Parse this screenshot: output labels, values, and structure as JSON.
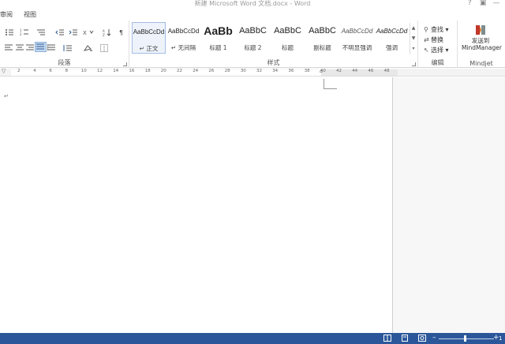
{
  "window": {
    "title": "新建 Microsoft Word 文档.docx - Word",
    "controls": [
      "?",
      "▣",
      "—"
    ]
  },
  "tabs": [
    "审阅",
    "视图"
  ],
  "ribbon": {
    "paragraph_group_label": "段落",
    "styles_group_label": "样式",
    "editing_group_label": "编辑",
    "mindjet_group_label": "Mindjet",
    "styles": [
      {
        "sample": "AaBbCcDd",
        "name": "↵ 正文",
        "selected": true
      },
      {
        "sample": "AaBbCcDd",
        "name": "↵ 无间隔",
        "selected": false
      },
      {
        "sample": "AaBb",
        "name": "标题 1",
        "selected": false
      },
      {
        "sample": "AaBbC",
        "name": "标题 2",
        "selected": false
      },
      {
        "sample": "AaBbC",
        "name": "标题",
        "selected": false
      },
      {
        "sample": "AaBbC",
        "name": "副标题",
        "selected": false
      },
      {
        "sample": "AaBbCcDd",
        "name": "不明显强调",
        "selected": false
      },
      {
        "sample": "AaBbCcDd",
        "name": "强调",
        "selected": false
      }
    ],
    "editing": {
      "find": "查找",
      "replace": "替换",
      "select": "选择"
    },
    "mindjet": {
      "line1": "发送到",
      "line2": "MindManager"
    }
  },
  "ruler": {
    "numbers": [
      "2",
      "4",
      "6",
      "8",
      "10",
      "12",
      "14",
      "16",
      "18",
      "20",
      "22",
      "24",
      "26",
      "28",
      "30",
      "32",
      "34",
      "36",
      "38",
      "40",
      "42",
      "44",
      "46",
      "48"
    ]
  },
  "document": {
    "paragraph_mark": "↵"
  },
  "statusbar": {
    "zoom_minus": "–",
    "zoom_plus": "+",
    "zoom_percent": "1",
    "zoom_level": 0.45
  },
  "colors": {
    "status_bar": "#2b579a",
    "accent": "#2b579a",
    "selected_style_border": "#a3bde3"
  }
}
